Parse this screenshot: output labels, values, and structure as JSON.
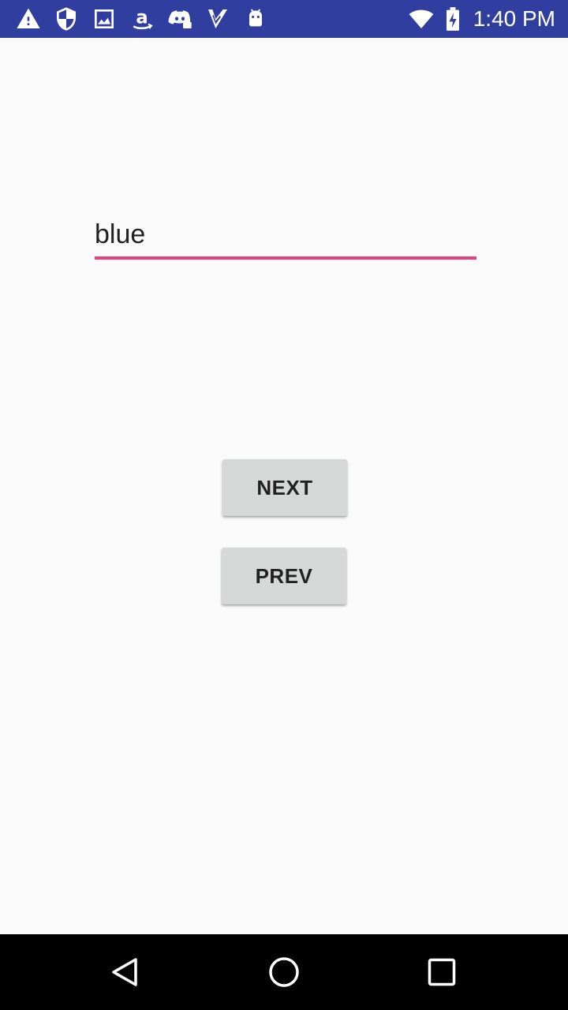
{
  "status_bar": {
    "time": "1:40 PM",
    "background_color": "#303f9f",
    "notification_icons": [
      "warning-icon",
      "shield-icon",
      "image-icon",
      "amazon-icon",
      "discord-icon",
      "check-icon",
      "android-icon"
    ],
    "system_icons": [
      "wifi-icon",
      "battery-charging-icon"
    ]
  },
  "form": {
    "text_value": "blue",
    "underline_color": "#ec407a"
  },
  "buttons": {
    "next_label": "NEXT",
    "prev_label": "PREV"
  },
  "nav_bar": {
    "buttons": [
      "back-icon",
      "home-icon",
      "recents-icon"
    ]
  }
}
